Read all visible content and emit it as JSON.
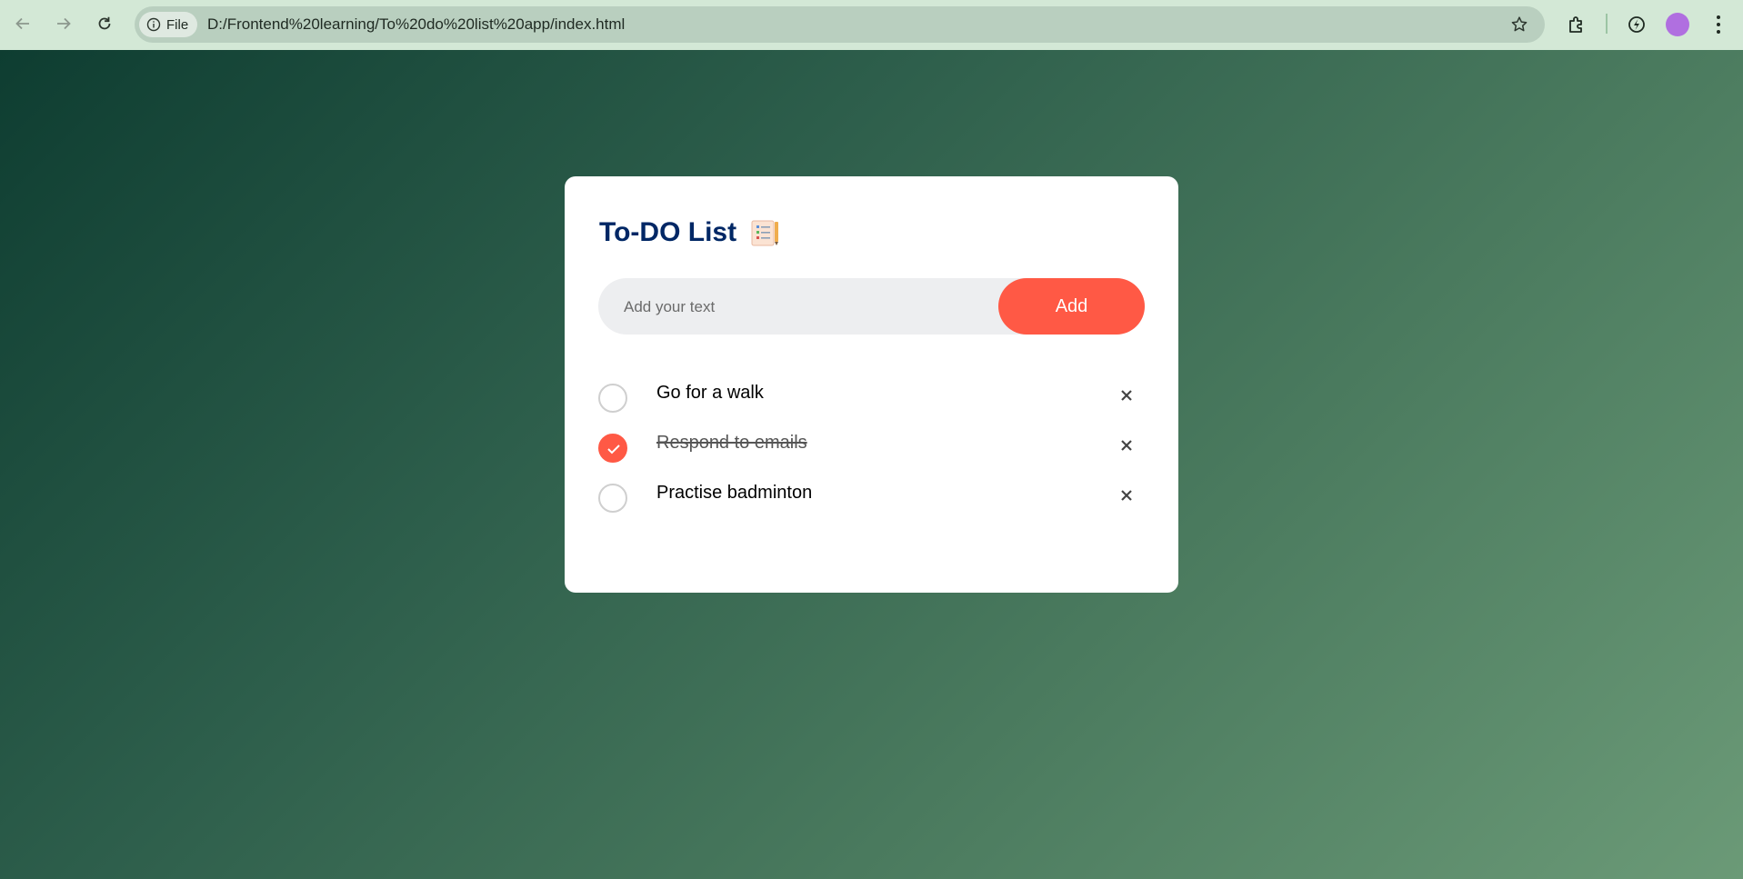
{
  "browser": {
    "site_chip_label": "File",
    "url": "D:/Frontend%20learning/To%20do%20list%20app/index.html",
    "icons": [
      "back-arrow-icon",
      "forward-arrow-icon",
      "reload-icon",
      "info-icon",
      "star-icon",
      "extensions-icon",
      "performance-icon",
      "avatar",
      "menu-kebab-icon"
    ]
  },
  "app": {
    "title": "To-DO List",
    "title_icon": "notepad-icon",
    "input_placeholder": "Add your text",
    "input_value": "",
    "add_label": "Add",
    "accent_color": "#ff5945",
    "title_color": "#002765",
    "tasks": [
      {
        "label": "Go for a walk",
        "done": false
      },
      {
        "label": "Respond to emails",
        "done": true
      },
      {
        "label": "Practise badminton",
        "done": false
      }
    ],
    "remove_symbol": "close-icon"
  }
}
